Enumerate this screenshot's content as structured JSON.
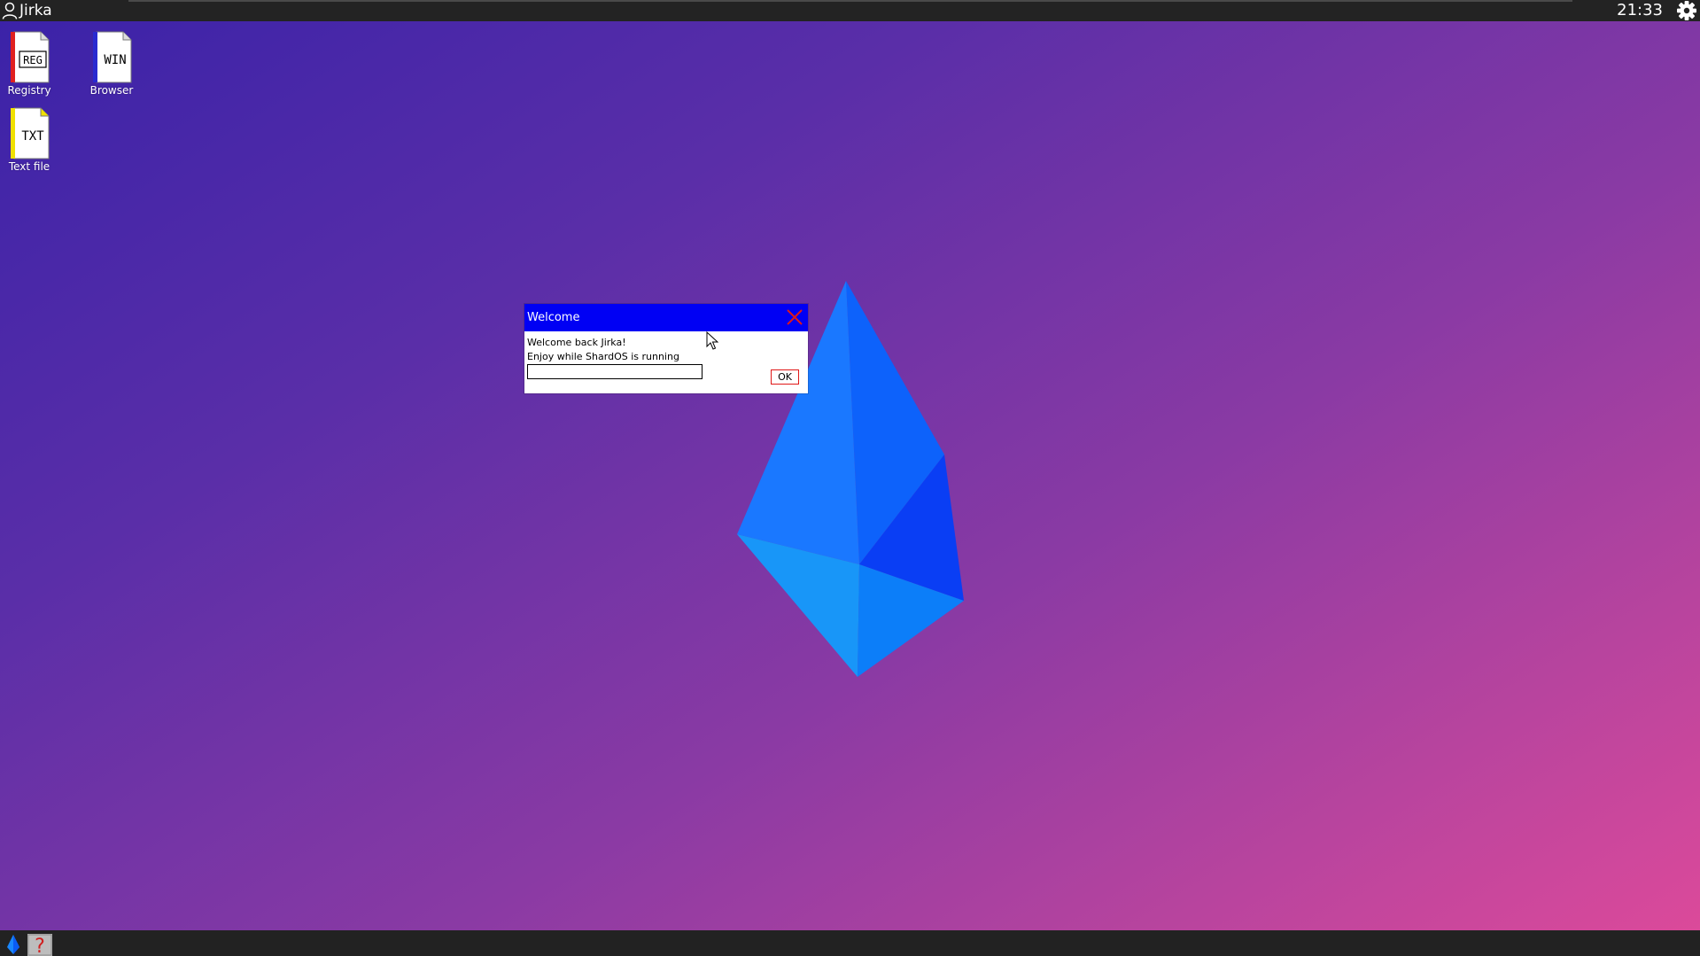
{
  "topbar": {
    "username": "Jirka",
    "clock": "21:33",
    "user_icon": "user-icon",
    "settings_icon": "gear-icon"
  },
  "desktop_icons": [
    {
      "label": "Registry",
      "badge": "REG",
      "accent": "#e02020"
    },
    {
      "label": "Browser",
      "badge": "WIN",
      "accent": "#2a2ad0"
    },
    {
      "label": "Text file",
      "badge": "TXT",
      "accent": "#f0e000"
    }
  ],
  "dialog": {
    "title": "Welcome",
    "message_line1": "Welcome back Jirka!",
    "message_line2": "Enjoy while ShardOS is running",
    "input_value": "",
    "ok_label": "OK",
    "close_icon": "close-icon"
  },
  "taskbar": {
    "start_icon": "shard-drop-icon",
    "app_icon": "question-mark-icon"
  },
  "colors": {
    "titlebar": "#0000f4",
    "close_x": "#e01818",
    "bar": "#232323",
    "shard_light": "#1a8cff",
    "shard_dark": "#0b3cf6"
  }
}
